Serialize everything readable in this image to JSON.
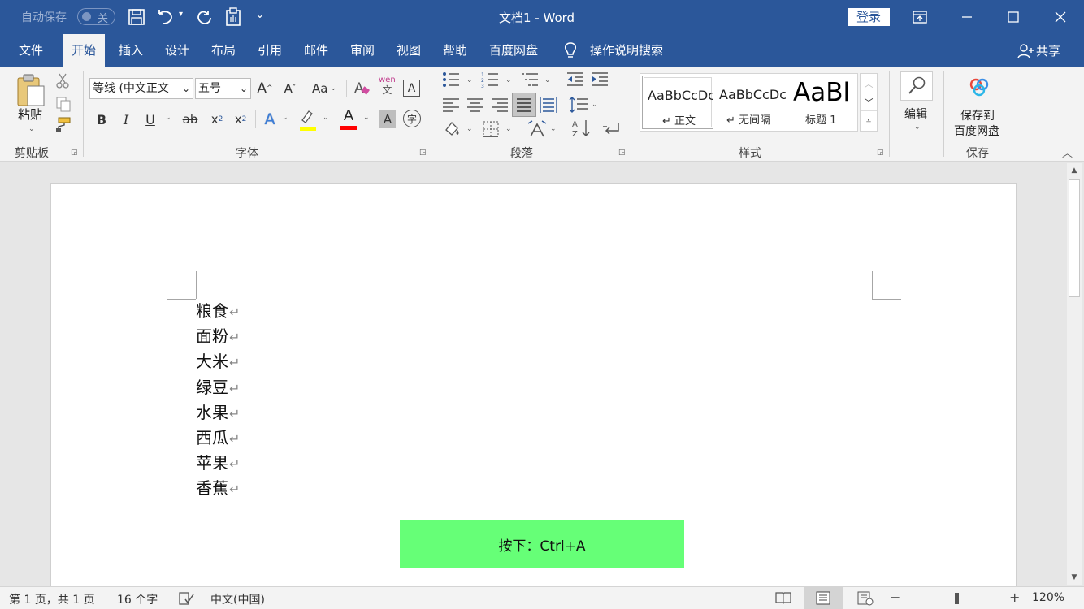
{
  "titlebar": {
    "autosave_label": "自动保存",
    "autosave_state": "关",
    "doc_title": "文档1  -  Word",
    "login_label": "登录",
    "icons": [
      "save-icon",
      "undo-icon",
      "redo-icon",
      "touch-mode-icon",
      "customize-qat-icon",
      "ribbon-display-icon",
      "minimize-icon",
      "maximize-icon",
      "close-icon"
    ]
  },
  "menu": {
    "items": [
      "文件",
      "开始",
      "插入",
      "设计",
      "布局",
      "引用",
      "邮件",
      "审阅",
      "视图",
      "帮助",
      "百度网盘"
    ],
    "active": "开始",
    "tell_me": "操作说明搜索",
    "share": "共享"
  },
  "ribbon": {
    "clipboard": {
      "paste": "粘贴",
      "label": "剪贴板"
    },
    "font": {
      "font_name": "等线 (中文正文",
      "font_size": "五号",
      "grow": "A",
      "shrink": "A",
      "case": "Aa",
      "phonetic_top": "wén",
      "phonetic_bottom": "文",
      "bold": "B",
      "italic": "I",
      "underline": "U",
      "strike": "ab",
      "sub": "x",
      "sup": "x",
      "effects": "A",
      "font_color": "A",
      "shading": "A",
      "enclose": "字",
      "label": "字体",
      "highlight_color": "#ffff00",
      "font_color_value": "#ff0000"
    },
    "paragraph": {
      "label": "段落"
    },
    "styles": {
      "items": [
        {
          "preview": "AaBbCcDc",
          "name": "↵ 正文"
        },
        {
          "preview": "AaBbCcDc",
          "name": "↵ 无间隔"
        },
        {
          "preview": "AaBl",
          "name": "标题 1"
        }
      ],
      "label": "样式"
    },
    "edit": {
      "label": "编辑"
    },
    "save": {
      "line1": "保存到",
      "line2": "百度网盘",
      "label": "保存"
    }
  },
  "document": {
    "lines": [
      "粮食",
      "面粉",
      "大米",
      "绿豆",
      "水果",
      "西瓜",
      "苹果",
      "香蕉"
    ],
    "paragraph_mark": "↵",
    "hint": "按下：Ctrl+A",
    "hint_color": "#66ff77"
  },
  "status": {
    "page": "第 1 页，共 1 页",
    "words": "16 个字",
    "language": "中文(中国)",
    "zoom": "120%",
    "zoom_minus": "−",
    "zoom_plus": "+"
  },
  "colors": {
    "brand": "#2b579a",
    "ribbon_bg": "#f3f3f3"
  }
}
